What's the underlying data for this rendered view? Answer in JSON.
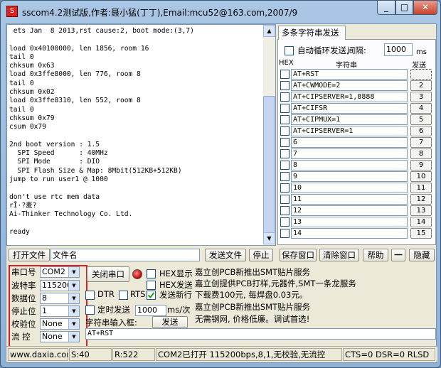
{
  "window": {
    "title": "sscom4.2测试版,作者:聂小猛(丁丁),Email:mcu52@163.com,2007/9",
    "minimize": "_",
    "maximize": "□",
    "close": "✕"
  },
  "terminal": {
    "text": " ets Jan  8 2013,rst cause:2, boot mode:(3,7)\n\nload 0x40100000, len 1856, room 16\ntail 0\nchksum 0x63\nload 0x3ffe8000, len 776, room 8\ntail 0\nchksum 0x02\nload 0x3ffe8310, len 552, room 8\ntail 0\nchksum 0x79\ncsum 0x79\n\n2nd boot version : 1.5\n  SPI Speed      : 40MHz\n  SPI Mode       : DIO\n  SPI Flash Size & Map: 8Mbit(512KB+512KB)\njump to run user1 @ 1000\n\ndon't use rtc mem data\nrÎ·?麦?\nAi-Thinker Technology Co. Ltd.\n\nready"
  },
  "multi_string": {
    "tab_label": "多条字符串发送",
    "auto_loop_label": "自动循环发送,",
    "interval_label": "间隔:",
    "interval_value": "1000",
    "interval_unit": "ms",
    "col_hex": "HEX",
    "col_string": "字符串",
    "col_send": "发送",
    "rows": [
      {
        "text": "AT+RST",
        "button": ""
      },
      {
        "text": "AT+CWMODE=2",
        "button": "2"
      },
      {
        "text": "AT+CIPSERVER=1,8888",
        "button": "3"
      },
      {
        "text": "AT+CIFSR",
        "button": "4"
      },
      {
        "text": "AT+CIPMUX=1",
        "button": "5"
      },
      {
        "text": "AT+CIPSERVER=1",
        "button": "6"
      },
      {
        "text": "6",
        "button": "7"
      },
      {
        "text": "7",
        "button": "8"
      },
      {
        "text": "8",
        "button": "9"
      },
      {
        "text": "9",
        "button": "10"
      },
      {
        "text": "10",
        "button": "11"
      },
      {
        "text": "11",
        "button": "12"
      },
      {
        "text": "12",
        "button": "13"
      },
      {
        "text": "13",
        "button": "14"
      },
      {
        "text": "14",
        "button": "15"
      }
    ]
  },
  "file_bar": {
    "open_file": "打开文件",
    "filename": "文件名",
    "send_file": "发送文件",
    "stop": "停止",
    "save_window": "保存窗口",
    "clear_window": "清除窗口",
    "help": "帮助",
    "dash": "一",
    "hide": "隐藏"
  },
  "port": {
    "port_label": "串口号",
    "port_value": "COM2",
    "baud_label": "波特率",
    "baud_value": "115200",
    "databits_label": "数据位",
    "databits_value": "8",
    "stopbits_label": "停止位",
    "stopbits_value": "1",
    "parity_label": "校验位",
    "parity_value": "None",
    "flow_label": "流 控",
    "flow_value": "None"
  },
  "controls": {
    "close_port": "关闭串口",
    "hex_show": "HEX显示",
    "hex_send": "HEX发送",
    "dtr": "DTR",
    "rts": "RTS",
    "send_newline": "发送新行",
    "timed_send": "定时发送",
    "timed_value": "1000",
    "timed_unit": "ms/次",
    "string_input_label": "字符串输入框:",
    "send": "发送",
    "send_input": "AT+RST"
  },
  "ad": {
    "line1": "嘉立创PCB新推出SMT贴片服务",
    "line2": "嘉立创提供PCB打样,元器件,SMT一条龙服务",
    "line3": "下载费100元, 每焊盘0.03元。",
    "line4": "嘉立创PCB新推出SMT贴片服务",
    "line5": "无需钢网, 价格低廉。调试首选!"
  },
  "status": {
    "url": "www.daxia.com",
    "s": "S:40",
    "r": "R:522",
    "port_status": "COM2已打开  115200bps,8,1,无校验,无流控",
    "lines": "CTS=0 DSR=0 RLSD"
  },
  "colors": {
    "highlight_box": "#e02020",
    "led": "#c00000"
  }
}
